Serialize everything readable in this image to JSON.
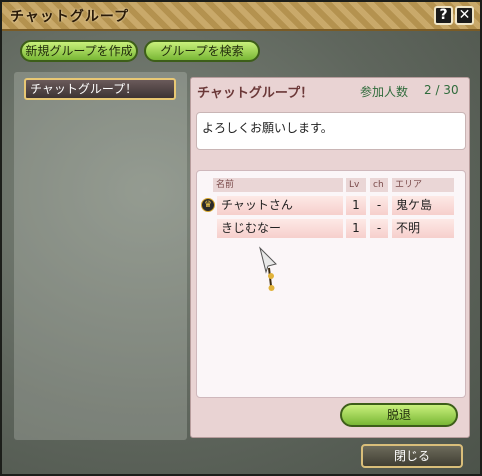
{
  "window": {
    "title": "チャットグループ",
    "help_label": "?",
    "close_label": "✕"
  },
  "toolbar": {
    "create_label": "新規グループを作成",
    "search_label": "グループを検索"
  },
  "group_list": [
    {
      "name": "チャットグループ！"
    }
  ],
  "group_detail": {
    "name": "チャットグループ！",
    "member_label": "参加人数",
    "member_count": "2 / 30",
    "message": "よろしくお願いします。"
  },
  "members": {
    "headers": {
      "name": "名前",
      "lv": "Lv",
      "ch": "ch",
      "area": "エリア"
    },
    "rows": [
      {
        "name": "チャットさん",
        "lv": "1",
        "ch": "-",
        "area": "鬼ケ島",
        "leader": true
      },
      {
        "name": "きじむなー",
        "lv": "1",
        "ch": "-",
        "area": "不明",
        "leader": false
      }
    ]
  },
  "actions": {
    "leave_label": "脱退",
    "close_label": "閉じる"
  },
  "icons": {
    "leader": "crown-icon",
    "cursor": "spear-cursor-icon"
  },
  "colors": {
    "title_bar": "#c9a96a",
    "accent_green": "#8bc83e",
    "panel_pink": "#e9d3d3"
  }
}
